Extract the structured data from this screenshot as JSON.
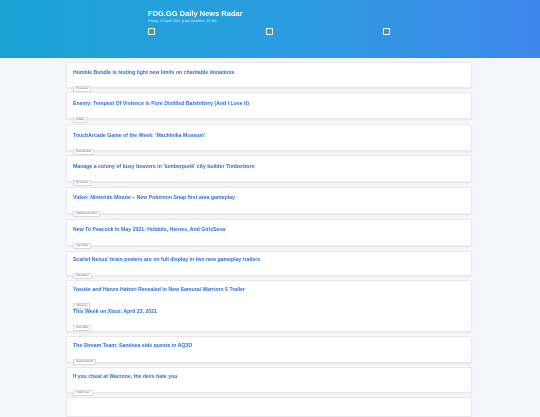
{
  "header": {
    "title": "FDG.GG Daily News Radar",
    "subtitle": "Friday, 23 April 2021 (Last Updated: 22:46)"
  },
  "news": [
    {
      "headline": "Humble Bundle is testing tight new limits on charitable donations",
      "source": "PC Gamer"
    },
    {
      "headline": "Enemy: Tempest Of Violence Is Pure Distilled Batshittery (And I Love It)",
      "source": "Kotaku"
    },
    {
      "headline": "TouchArcade Game of the Week: 'Machinika Museum'",
      "source": "TouchArcade"
    },
    {
      "headline": "Manage a colony of busy beavers in 'lumberpunk' city builder Timberborn",
      "source": "PC Gamer"
    },
    {
      "headline": "Video: Nintendo Minute – New Pokémon Snap first area gameplay",
      "source": "GoNintendo Video"
    },
    {
      "headline": "New To Peacock In May 2021: Hobbits, Heroes, And GirlsSeva",
      "source": "GameSpot"
    },
    {
      "headline": "Scarlet Nexus' brain-powers are on full display in two new gameplay trailers",
      "source": "GameZone"
    },
    {
      "headline": "Yasuke and Hanzo Hattori Revealed in New Samurai Warriors 5 Trailer",
      "source": "Siliconera"
    },
    {
      "headline": "This Week on Xbox: April 23, 2021",
      "source": "Xbox Wire"
    },
    {
      "headline": "The Stream Team: Sandsea side quests in AQ3D",
      "source": "Destructoid PC"
    },
    {
      "headline": "If you cheat at Warzone, the devs hate you",
      "source": "VG247.com"
    }
  ]
}
